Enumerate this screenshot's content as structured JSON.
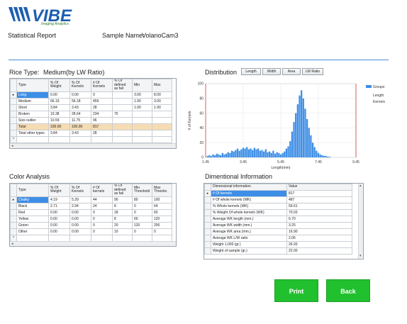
{
  "header": {
    "logo_text": "VIBE",
    "logo_subtitle": "Imaging Analytics",
    "report_title": "Statistical Report",
    "sample_label": "Sample Name:",
    "sample_value": "VolanoCam3"
  },
  "rice_type": {
    "label": "Rice Type:",
    "value": "Medium(by LW Ratio)",
    "columns": [
      "Type",
      "% Of Weight",
      "% Of Kernels",
      "# Of Kernels",
      "% Of defined as fail",
      "Min",
      "Max"
    ],
    "rows": [
      [
        "Long",
        "0.00",
        "0.00",
        "0",
        "",
        "3.00",
        "8.00"
      ],
      [
        "Medium",
        "66.19",
        "56.18",
        "459",
        "",
        "1.90",
        "3.00"
      ],
      [
        "Short",
        "3.84",
        "3.43",
        "28",
        "",
        "1.00",
        "1.90"
      ],
      [
        "Broken",
        "19.38",
        "28.64",
        "234",
        "75",
        "",
        ""
      ],
      [
        "Size outlier",
        "10.59",
        "11.75",
        "96",
        "",
        "",
        ""
      ],
      [
        "Total",
        "100.00",
        "100.00",
        "817",
        "",
        "",
        ""
      ],
      [
        "Total other types",
        "3.84",
        "3.43",
        "28",
        "",
        "",
        ""
      ]
    ]
  },
  "color_analysis": {
    "label": "Color Analysis",
    "columns": [
      "Type",
      "% Of Weight",
      "% Of Kernels",
      "# Of kernels",
      "% Of defined as fail",
      "Min Threshold",
      "Max Thresho"
    ],
    "rows": [
      [
        "Chalky",
        "4.19",
        "5.39",
        "44",
        "90",
        "80",
        "100"
      ],
      [
        "Black",
        "2.71",
        "2.94",
        "24",
        "8",
        "0",
        "64"
      ],
      [
        "Red",
        "0.00",
        "0.00",
        "0",
        "18",
        "0",
        "60"
      ],
      [
        "Yellow",
        "0.00",
        "0.00",
        "0",
        "8",
        "60",
        "120"
      ],
      [
        "Green",
        "0.00",
        "0.00",
        "0",
        "20",
        "120",
        "200"
      ],
      [
        "Other",
        "0.00",
        "0.00",
        "0",
        "10",
        "0",
        "0"
      ]
    ]
  },
  "distribution": {
    "label": "Distribution",
    "buttons": [
      "Length",
      "Width",
      "Area",
      "LW Ratio"
    ]
  },
  "dimensional": {
    "label": "Dimentional Information",
    "columns": [
      "Dimensional information",
      "Value"
    ],
    "rows": [
      [
        "# Of kernels",
        "817"
      ],
      [
        "# Of whole kernels (WK)",
        "487"
      ],
      [
        "% Whole kernels (WK)",
        "59.61"
      ],
      [
        "% Weight Of whole kernels (WK)",
        "70.03"
      ],
      [
        "Average WK length (mm.)",
        "6.70"
      ],
      [
        "Average WK width (mm.)",
        "3.25"
      ],
      [
        "Average WK area (mm.)",
        "16.90"
      ],
      [
        "Average WK L/W ratio",
        "2.06"
      ],
      [
        "Weight 1,000 (gr.)",
        "26.93"
      ],
      [
        "Weight of sample (gr.)",
        "22.00"
      ]
    ]
  },
  "chart_data": {
    "type": "bar",
    "xlabel": "Length(mm)",
    "ylabel": "# of Kernels",
    "xlim": [
      1.45,
      9.45
    ],
    "ylim": [
      0,
      100
    ],
    "xticks": [
      "1.45",
      "3.45",
      "5.45",
      "7.45",
      "9.45"
    ],
    "yticks": [
      "0",
      "20",
      "40",
      "60",
      "80",
      "100"
    ],
    "legend": {
      "position": "top-right",
      "entries": [
        "Groups"
      ],
      "notes": [
        "Length",
        "Kernels"
      ]
    },
    "grid": true,
    "bar_color": "#3d8ee6",
    "threshold_color": "#d04040",
    "thresholds": [
      1.45,
      9.45
    ],
    "series": [
      {
        "name": "Groups",
        "x": [
          1.55,
          1.65,
          1.75,
          1.85,
          1.95,
          2.05,
          2.15,
          2.25,
          2.35,
          2.45,
          2.55,
          2.65,
          2.75,
          2.85,
          2.95,
          3.05,
          3.15,
          3.25,
          3.35,
          3.45,
          3.55,
          3.65,
          3.75,
          3.85,
          3.95,
          4.05,
          4.15,
          4.25,
          4.35,
          4.45,
          4.55,
          4.65,
          4.75,
          4.85,
          4.95,
          5.05,
          5.15,
          5.25,
          5.35,
          5.45,
          5.55,
          5.65,
          5.75,
          5.85,
          5.95,
          6.05,
          6.15,
          6.25,
          6.35,
          6.45,
          6.55,
          6.65,
          6.75,
          6.85,
          6.95,
          7.05,
          7.15,
          7.25,
          7.35,
          7.45,
          7.55,
          7.65,
          7.75,
          7.85,
          7.95,
          8.05
        ],
        "values": [
          2,
          3,
          2,
          4,
          3,
          5,
          4,
          3,
          6,
          4,
          5,
          7,
          6,
          9,
          8,
          10,
          12,
          9,
          11,
          13,
          12,
          14,
          11,
          12,
          10,
          13,
          11,
          12,
          9,
          10,
          8,
          11,
          7,
          8,
          6,
          9,
          5,
          7,
          6,
          4,
          6,
          8,
          12,
          15,
          22,
          35,
          48,
          60,
          72,
          84,
          91,
          80,
          66,
          52,
          40,
          30,
          20,
          14,
          9,
          6,
          4,
          3,
          2,
          2,
          1,
          1
        ]
      }
    ]
  },
  "actions": {
    "print": "Print",
    "back": "Back"
  }
}
